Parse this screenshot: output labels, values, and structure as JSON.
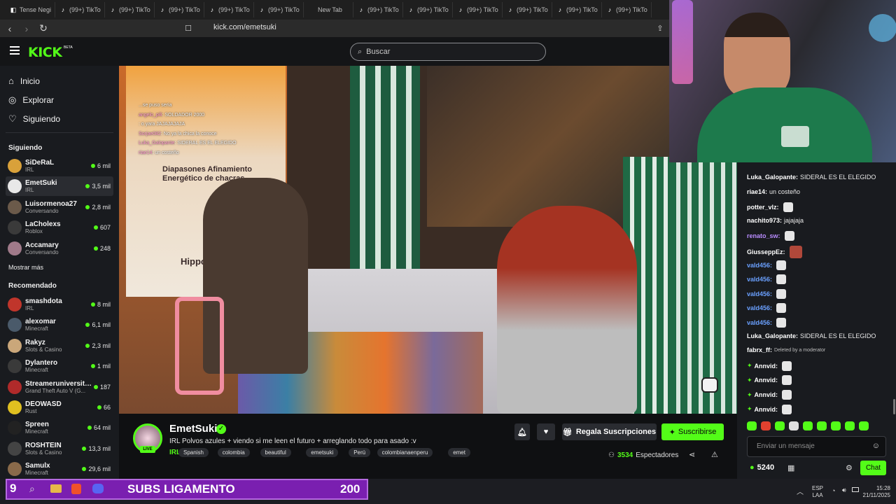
{
  "browser": {
    "tabs": [
      {
        "label": "Tense Negi"
      },
      {
        "label": "(99+) TikTo"
      },
      {
        "label": "(99+) TikTo"
      },
      {
        "label": "(99+) TikTo"
      },
      {
        "label": "(99+) TikTo"
      },
      {
        "label": "(99+) TikTo"
      },
      {
        "label": "New Tab"
      },
      {
        "label": "(99+) TikTo"
      },
      {
        "label": "(99+) TikTo"
      },
      {
        "label": "(99+) TikTo"
      },
      {
        "label": "(99+) TikTo"
      },
      {
        "label": "(99+) TikTo"
      },
      {
        "label": "(99+) TikTo"
      }
    ],
    "url": "kick.com/emetsuki"
  },
  "header": {
    "logo": "KICK",
    "beta": "BETA",
    "search_placeholder": "Buscar"
  },
  "sidebar": {
    "nav": [
      {
        "label": "Inicio",
        "icon": "home-icon"
      },
      {
        "label": "Explorar",
        "icon": "compass-icon"
      },
      {
        "label": "Siguiendo",
        "icon": "heart-icon"
      }
    ],
    "following_title": "Siguiendo",
    "following": [
      {
        "name": "SiDeRaL",
        "category": "IRL",
        "viewers": "6 mil"
      },
      {
        "name": "EmetSuki",
        "category": "IRL",
        "viewers": "3,5 mil"
      },
      {
        "name": "Luisormenoa27",
        "category": "Conversando",
        "viewers": "2,8 mil"
      },
      {
        "name": "LaCholexs",
        "category": "Roblox",
        "viewers": "607"
      },
      {
        "name": "Accamary",
        "category": "Conversando",
        "viewers": "248"
      }
    ],
    "show_more": "Mostrar más",
    "recommended_title": "Recomendado",
    "recommended": [
      {
        "name": "smashdota",
        "category": "IRL",
        "viewers": "8 mil"
      },
      {
        "name": "alexomar",
        "category": "Minecraft",
        "viewers": "6,1 mil"
      },
      {
        "name": "Rakyz",
        "category": "Slots & Casino",
        "viewers": "2,3 mil"
      },
      {
        "name": "Dylantero",
        "category": "Minecraft",
        "viewers": "1 mil"
      },
      {
        "name": "Streameruniversita...",
        "category": "Grand Theft Auto V (G...",
        "viewers": "187"
      },
      {
        "name": "DEOWASD",
        "category": "Rust",
        "viewers": "66"
      },
      {
        "name": "Spreen",
        "category": "Minecraft",
        "viewers": "64 mil"
      },
      {
        "name": "ROSHTEIN",
        "category": "Slots & Casino",
        "viewers": "13,3 mil"
      },
      {
        "name": "Samulx",
        "category": "Minecraft",
        "viewers": "29,6 mil"
      }
    ]
  },
  "video": {
    "overlay_lines": [
      {
        "user": "",
        "text": "...se puso seria"
      },
      {
        "user": "angelo_pili",
        "text": ": SOLDADOR 2000"
      },
      {
        "user": "",
        "text": ": o yara JAJAJAJAJA"
      },
      {
        "user": "Sorjae082",
        "text": ": No ya la chica la conoce"
      },
      {
        "user": "Luka_Galopante",
        "text": ": SIDERAL ES EL ELEGIDO"
      },
      {
        "user": "riae14",
        "text": ": un costeño"
      }
    ],
    "poster_text": "Diapasones Afinamiento Energético de chacras",
    "poster_word": "Hippo",
    "watermark": "t2446"
  },
  "stream": {
    "name": "EmetSuki",
    "live": "LIVE",
    "title": "IRL Polvos azules + viendo si me leen el futuro + arreglando todo para asado :v",
    "category": "IRL",
    "tags": [
      "Spanish",
      "colombia",
      "beautiful",
      "emetsuki",
      "Perú",
      "colombianaenperu",
      "emet"
    ],
    "gift_label": "Regala Suscripciones",
    "subscribe_label": "Suscribirse",
    "viewers_count": "3534",
    "viewers_label": "Espectadores"
  },
  "chat": {
    "messages": [
      {
        "user": "Luka_Galopante:",
        "text": "SIDERAL ES EL ELEGIDO",
        "color": "#ffffff",
        "emote": false
      },
      {
        "user": "riae14:",
        "text": "un costeño",
        "color": "#ffffff",
        "emote": false
      },
      {
        "user": "potter_vlz:",
        "text": "",
        "color": "#ffffff",
        "emote": true
      },
      {
        "user": "nachito973:",
        "text": "jajajaja",
        "color": "#ffffff",
        "emote": false
      },
      {
        "user": "renato_sw:",
        "text": "",
        "color": "#b98cff",
        "emote": true
      },
      {
        "user": "GiusseppEz:",
        "text": "",
        "color": "#ffffff",
        "emote": true
      },
      {
        "user": "vald456:",
        "text": "",
        "color": "#6aa0ff",
        "emote": true
      },
      {
        "user": "vald456:",
        "text": "",
        "color": "#6aa0ff",
        "emote": true
      },
      {
        "user": "vald456:",
        "text": "",
        "color": "#6aa0ff",
        "emote": true
      },
      {
        "user": "vald456:",
        "text": "",
        "color": "#6aa0ff",
        "emote": true
      },
      {
        "user": "vald456:",
        "text": "",
        "color": "#6aa0ff",
        "emote": true
      },
      {
        "user": "Luka_Galopante:",
        "text": "SIDERAL ES EL ELEGIDO",
        "color": "#ffffff",
        "emote": false
      },
      {
        "user": "fabrx_ff:",
        "text": "Deleted by a moderator",
        "color": "#ffffff",
        "emote": false
      },
      {
        "user": "Annvid:",
        "text": "",
        "color": "#ffffff",
        "emote": true
      },
      {
        "user": "Annvid:",
        "text": "",
        "color": "#ffffff",
        "emote": true
      },
      {
        "user": "Annvid:",
        "text": "",
        "color": "#ffffff",
        "emote": true
      },
      {
        "user": "Annvid:",
        "text": "",
        "color": "#ffffff",
        "emote": true
      }
    ],
    "input_placeholder": "Enviar un mensaje",
    "points": "5240",
    "send_label": "Chat"
  },
  "taskbar": {
    "widget_number": "9",
    "widget_title": "SUBS LIGAMENTO",
    "widget_count": "200",
    "lang": "ESP",
    "layout": "LAA",
    "time": "15:28",
    "date": "21/11/2025"
  },
  "colors": {
    "accent": "#53fc18",
    "sidebar_bg": "#191b1f",
    "chat_bg": "#191b1f",
    "widget_bg": "#7a1fb0"
  }
}
